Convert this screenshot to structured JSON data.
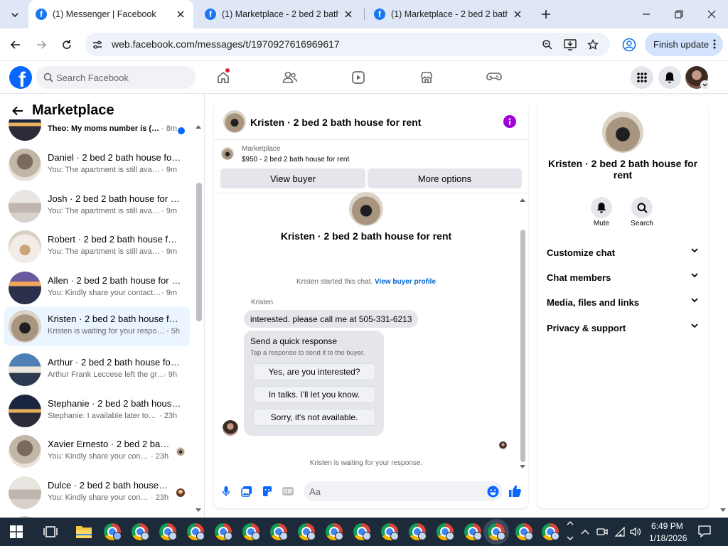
{
  "browser": {
    "tabs": [
      {
        "title": "(1) Messenger | Facebook",
        "active": true
      },
      {
        "title": "(1) Marketplace - 2 bed 2 bath",
        "active": false
      },
      {
        "title": "(1) Marketplace - 2 bed 2 bath",
        "active": false
      }
    ],
    "url": "web.facebook.com/messages/t/1970927616969617",
    "finish_update_label": "Finish update"
  },
  "fb_header": {
    "logo_letter": "f",
    "search_placeholder": "Search Facebook"
  },
  "left_panel": {
    "title": "Marketplace",
    "conversations": [
      {
        "name": "",
        "preview": "Theo: My moms number is (42...",
        "time": "· 8m",
        "avatar": "av-g",
        "unread": true
      },
      {
        "name": "Daniel · 2 bed 2 bath house for ...",
        "preview": "You: The apartment is still availabl...",
        "time": "· 9m",
        "avatar": "av-a"
      },
      {
        "name": "Josh · 2 bed 2 bath house for rent",
        "preview": "You: The apartment is still availabl...",
        "time": "· 9m",
        "avatar": "av-b"
      },
      {
        "name": "Robert · 2 bed 2 bath house for ...",
        "preview": "You: The apartment is still availabl...",
        "time": "· 9m",
        "avatar": "av-c"
      },
      {
        "name": "Allen · 2 bed 2 bath house for r...",
        "preview": "You: Kindly share your contact nu...",
        "time": "· 9m",
        "avatar": "av-d"
      },
      {
        "name": "Kristen · 2 bed 2 bath house for...",
        "preview": "Kristen is waiting for your response.",
        "time": "· 5h",
        "avatar": "av-e",
        "selected": true
      },
      {
        "name": "Arthur · 2 bed 2 bath house for ...",
        "preview": "Arthur Frank Leccese left the group.",
        "time": "· 9h",
        "avatar": "av-f"
      },
      {
        "name": "Stephanie · 2 bed 2 bath house ...",
        "preview": "Stephanie: I available later today i...",
        "time": "· 23h",
        "avatar": "av-g"
      },
      {
        "name": "Xavier Ernesto · 2 bed 2 bath ...",
        "preview": "You: Kindly share your contact ...",
        "time": "· 23h",
        "avatar": "av-a",
        "read_receipt": true
      },
      {
        "name": "Dulce · 2 bed 2 bath house fo...",
        "preview": "You: Kindly share your contact ...",
        "time": "· 23h",
        "avatar": "av-b",
        "read_receipt": true
      }
    ]
  },
  "chat": {
    "header_title": "Kristen · 2 bed 2 bath house for rent",
    "listing": {
      "source": "Marketplace",
      "price_line": "$950 - 2 bed 2 bath house for rent"
    },
    "view_buyer_label": "View buyer",
    "more_options_label": "More options",
    "profile_name": "Kristen · 2 bed 2 bath house for rent",
    "started_text": "Kristen started this chat.",
    "view_profile_link": "View buyer profile",
    "sender": "Kristen",
    "message": "interested. please call me at 505-331-6213",
    "quick_response": {
      "title": "Send a quick response",
      "subtitle": "Tap a response to send it to the buyer.",
      "options": [
        "Yes, are you interested?",
        "In talks. I'll let you know.",
        "Sorry, it's not available."
      ]
    },
    "waiting_text": "Kristen is waiting for your response.",
    "composer_placeholder": "Aa",
    "gif_label": "GIF"
  },
  "right_panel": {
    "name": "Kristen · 2 bed 2 bath house for rent",
    "mute_label": "Mute",
    "search_label": "Search",
    "sections": [
      "Customize chat",
      "Chat members",
      "Media, files and links",
      "Privacy & support"
    ]
  },
  "taskbar": {
    "time": "6:49 PM",
    "date": "1/18/2026"
  },
  "colors": {
    "fb_blue": "#0866ff",
    "selected_row": "#ebf5ff",
    "info_purple": "#9b00d9",
    "taskbar": "#1c2a39"
  }
}
